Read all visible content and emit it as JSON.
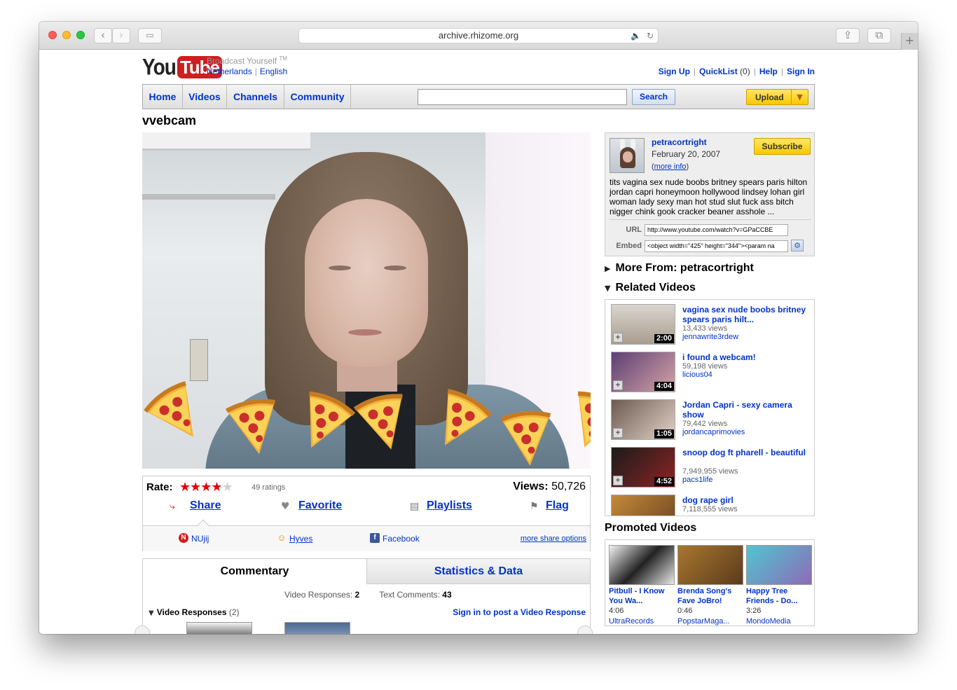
{
  "browser": {
    "url": "archive.rhizome.org",
    "back_icon": "‹",
    "forward_icon": "›",
    "sidebar_icon": "▭",
    "audio_icon": "🔈",
    "reload_icon": "↻",
    "share_icon": "⇪",
    "tabs_icon": "⧉",
    "new_tab_icon": "+"
  },
  "header": {
    "logo_you": "You",
    "logo_tube": "Tube",
    "tagline": "Broadcast Yourself",
    "tm": "TM",
    "country": "Netherlands",
    "language": "English",
    "sign_up": "Sign Up",
    "quicklist": "QuickList",
    "quicklist_count": "(0)",
    "help": "Help",
    "sign_in": "Sign In"
  },
  "nav": {
    "home": "Home",
    "videos": "Videos",
    "channels": "Channels",
    "community": "Community",
    "search_value": "",
    "search_button": "Search",
    "upload_button": "Upload"
  },
  "video": {
    "title": "vvebcam",
    "rate_label": "Rate:",
    "rating": 4,
    "max_rating": 5,
    "ratings_count": "49 ratings",
    "views_label": "Views:",
    "views_count": "50,726"
  },
  "actions": {
    "share": "Share",
    "favorite": "Favorite",
    "playlists": "Playlists",
    "flag": "Flag"
  },
  "share_options": {
    "nujij": "NUjij",
    "hyves": "Hyves",
    "facebook": "Facebook",
    "more": "more share options"
  },
  "tabs": {
    "commentary": "Commentary",
    "stats": "Statistics & Data",
    "video_responses_label": "Video Responses:",
    "video_responses_count": "2",
    "text_comments_label": "Text Comments:",
    "text_comments_count": "43",
    "vr_title": "Video Responses",
    "vr_count": "(2)",
    "vr_signin": "Sign in to post a Video Response"
  },
  "channel": {
    "name": "petracortright",
    "date": "February 20, 2007",
    "more_info_open": "(",
    "more_info": "more info",
    "more_info_close": ")",
    "subscribe": "Subscribe",
    "description": "tits vagina sex nude boobs britney spears paris hilton jordan capri honeymoon hollywood lindsey lohan girl woman lady sexy man hot stud slut fuck ass bitch nigger chink gook cracker beaner asshole ...",
    "url_label": "URL",
    "url_value": "http://www.youtube.com/watch?v=GPaCCBE",
    "embed_label": "Embed",
    "embed_value": "<object width=\"425\" height=\"344\"><param na"
  },
  "sidebar": {
    "more_from": "More From: petracortright",
    "related_title": "Related Videos",
    "promoted_title": "Promoted Videos",
    "related": [
      {
        "title": "vagina sex nude boobs britney spears paris hilt...",
        "views": "13,433 views",
        "user": "jennawrite3rdew",
        "duration": "2:00"
      },
      {
        "title": "i found a webcam!",
        "views": "59,198 views",
        "user": "licious04",
        "duration": "4:04"
      },
      {
        "title": "Jordan Capri - sexy camera show",
        "views": "79,442 views",
        "user": "jordancaprimovies",
        "duration": "1:05"
      },
      {
        "title": "snoop dog ft pharell - beautiful",
        "views": "7,949,955 views",
        "user": "pacs1life",
        "duration": "4:52"
      },
      {
        "title": "dog rape girl",
        "views": "7,118,555 views",
        "user": "",
        "duration": ""
      }
    ],
    "promoted": [
      {
        "title": "Pitbull - I Know You Wa...",
        "duration": "4:06",
        "user": "UltraRecords"
      },
      {
        "title": "Brenda Song's Fave JoBro!",
        "duration": "0:46",
        "user": "PopstarMaga..."
      },
      {
        "title": "Happy Tree Friends - Do...",
        "duration": "3:26",
        "user": "MondoMedia"
      }
    ]
  }
}
